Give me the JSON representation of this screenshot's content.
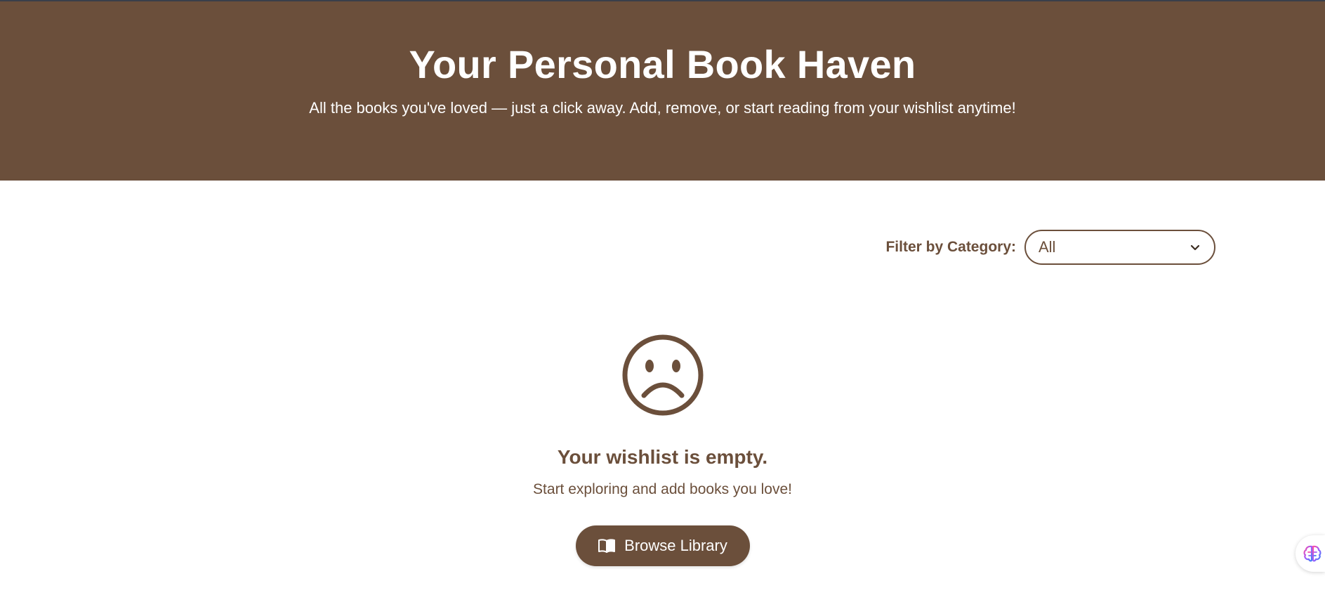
{
  "header": {
    "title": "Your Personal Book Haven",
    "subtitle": "All the books you've loved — just a click away. Add, remove, or start reading from your wishlist anytime!"
  },
  "filter": {
    "label": "Filter by Category:",
    "selected": "All"
  },
  "empty_state": {
    "icon": "sad-face-icon",
    "title": "Your wishlist is empty.",
    "subtitle": "Start exploring and add books you love!",
    "button_label": "Browse Library",
    "button_icon": "book-icon"
  },
  "floating_widget": {
    "icon": "brain-icon"
  },
  "colors": {
    "brand_brown": "#6b4f3b",
    "white": "#ffffff",
    "top_border": "#3a3f4a"
  }
}
